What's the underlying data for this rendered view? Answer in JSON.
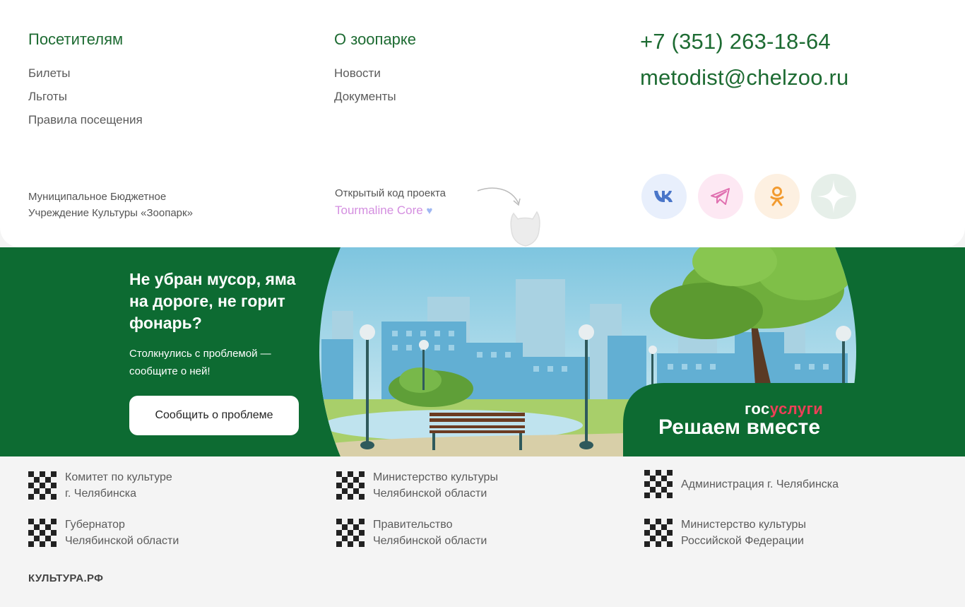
{
  "footer": {
    "visitors": {
      "title": "Посетителям",
      "links": [
        "Билеты",
        "Льготы",
        "Правила посещения"
      ]
    },
    "about": {
      "title": "О зоопарке",
      "links": [
        "Новости",
        "Документы"
      ]
    },
    "contacts": {
      "phone": "+7 (351) 263-18-64",
      "email": "metodist@chelzoo.ru"
    },
    "organization": {
      "line1": "Муниципальное Бюджетное",
      "line2": "Учреждение Культуры «Зоопарк»"
    },
    "open_source": {
      "label": "Открытый код проекта",
      "link": "Tourmaline Core",
      "heart": "♥"
    },
    "social": [
      {
        "name": "vk",
        "icon": "vk-icon",
        "bg": "#e8effc",
        "color": "#4a76c9"
      },
      {
        "name": "telegram",
        "icon": "telegram-icon",
        "bg": "#fde8f3",
        "color": "#e070b0"
      },
      {
        "name": "odnoklassniki",
        "icon": "ok-icon",
        "bg": "#fdf0e1",
        "color": "#f29b30"
      },
      {
        "name": "dzen",
        "icon": "dzen-icon",
        "bg": "#e6efe9",
        "color": "#ffffff"
      }
    ]
  },
  "banner": {
    "title": "Не убран мусор, яма на дороге, не горит фонарь?",
    "subtitle": "Столкнулись с проблемой — сообщите о ней!",
    "button": "Сообщить о проблеме",
    "brand_gos": "гос",
    "brand_uslugi": "услуги",
    "slogan": "Решаем вместе",
    "colors": {
      "green": "#0d6b32",
      "red": "#ee3f58"
    }
  },
  "partners": [
    {
      "text": "Комитет по культуре\n г. Челябинска"
    },
    {
      "text": "Министерство культуры\nЧелябинской области"
    },
    {
      "text": "Администрация г. Челябинска"
    },
    {
      "text": "Губернатор\nЧелябинской области"
    },
    {
      "text": "Правительство\nЧелябинской области"
    },
    {
      "text": "Министерство культуры\nРоссийской Федерации"
    }
  ],
  "kultura": "КУЛЬТУРА.РФ"
}
